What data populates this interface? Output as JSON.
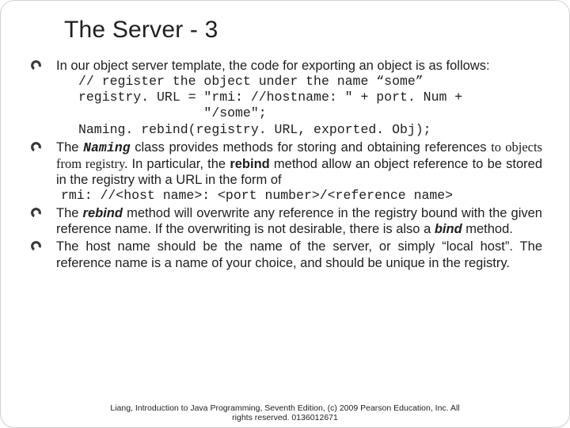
{
  "title": "The Server - 3",
  "bullets": {
    "b1": {
      "intro": "In our object server template, the code for exporting an object is as follows:",
      "code1": "// register the object under the name “some”",
      "code2": "registry. URL = \"rmi: //hostname: \" + port. Num +",
      "code3": "                \"/some\";",
      "code4": "Naming. rebind(registry. URL, exported. Obj);"
    },
    "b2": {
      "p_a": "The ",
      "p_b": "Naming",
      "p_c": " class provides methods for storing and obtaining references ",
      "p_d": "to objects from registry.",
      "p_e": "  In particular, the ",
      "p_f": "rebind",
      "p_g": " method allow an object reference to be stored in the registry with a URL in the form of",
      "code": "rmi: //<host name>: <port number>/<reference name>"
    },
    "b3": {
      "p_a": "The ",
      "p_b": "rebind",
      "p_c": " method will overwrite any reference in the registry bound with the given reference name.  If the overwriting is not desirable, there is also a ",
      "p_d": "bind",
      "p_e": " method."
    },
    "b4": {
      "text": "The host name should be the name of the server, or simply “local host”.  The reference name is a name of your choice, and should be unique in the registry."
    }
  },
  "footer": {
    "line1": "Liang, Introduction to Java Programming, Seventh Edition, (c) 2009 Pearson Education, Inc. All",
    "line2": "rights reserved. 0136012671"
  }
}
